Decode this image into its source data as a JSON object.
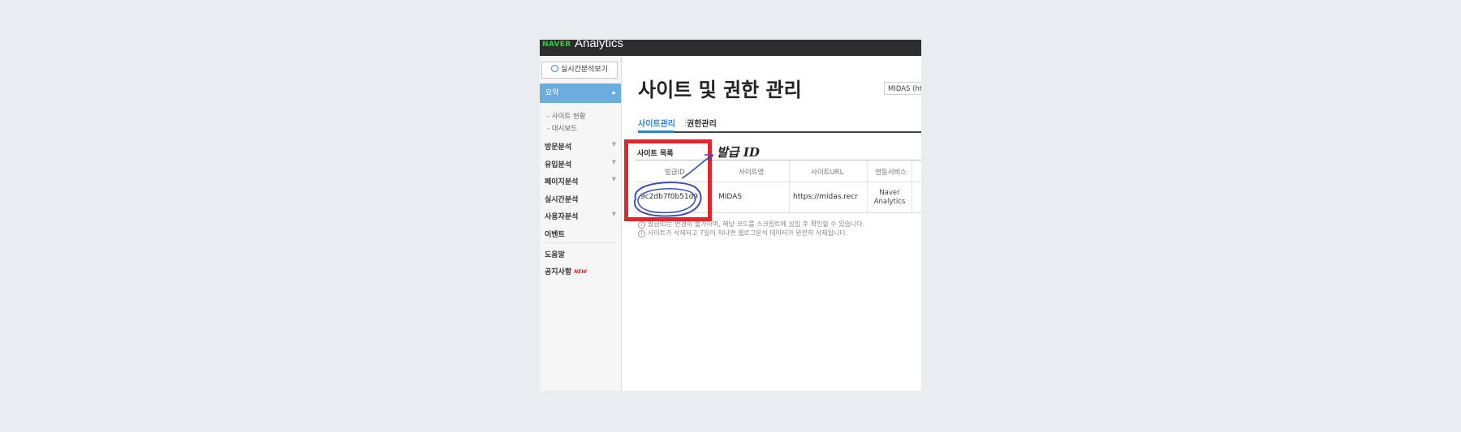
{
  "topbar": {
    "logo": "NAVER",
    "product": "Analytics"
  },
  "sidebar": {
    "realtime_button": "실시간분석보기",
    "active_item": "요약",
    "subitems": [
      "- 사이트 현황",
      "- 대시보드"
    ],
    "items": [
      {
        "label": "방문분석",
        "has_chevron": true
      },
      {
        "label": "유입분석",
        "has_chevron": true
      },
      {
        "label": "페이지분석",
        "has_chevron": true
      },
      {
        "label": "실시간분석",
        "has_chevron": false
      },
      {
        "label": "사용자분석",
        "has_chevron": true
      },
      {
        "label": "이벤트",
        "has_chevron": false
      }
    ],
    "help": "도움말",
    "notice": "공지사항",
    "notice_badge": "NEW"
  },
  "main": {
    "title": "사이트 및 권한 관리",
    "site_select": "MIDAS (https://midas.recruiter.co.kr)",
    "tabs": [
      {
        "label": "사이트관리",
        "active": true
      },
      {
        "label": "권한관리",
        "active": false
      }
    ],
    "section_title": "사이트 목록",
    "table": {
      "headers": [
        "발급ID",
        "사이트명",
        "사이트URL",
        "연동서비스"
      ],
      "rows": [
        {
          "id": "9c2db7f0b51d9",
          "name": "MIDAS",
          "url": "https://midas.recruiter.co.kr",
          "service": "Naver Analytics"
        }
      ]
    },
    "notes": [
      "발급ID는 변경이 불가하며, 해당 코드를 스크립트에 삽입 후 확인할 수 있습니다.",
      "사이트가 삭제되고 7일이 지나면 웹로그분석 데이터가 완전히 삭제됩니다."
    ]
  },
  "annotation": {
    "label": "발급 ID",
    "box_color": "#e3262b",
    "scribble_color": "#3b4fb0"
  }
}
